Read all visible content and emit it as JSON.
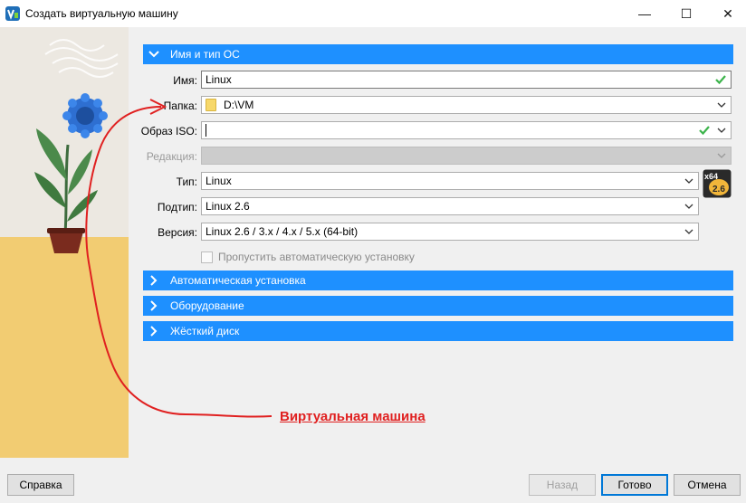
{
  "window": {
    "title": "Создать виртуальную машину",
    "controls": {
      "minimize": "—",
      "maximize": "☐",
      "close": "✕"
    }
  },
  "sections": {
    "name_os": "Имя и тип ОС",
    "unattended": "Автоматическая установка",
    "hardware": "Оборудование",
    "hard_disk": "Жёсткий диск"
  },
  "form": {
    "name": {
      "label": "Имя:",
      "value": "Linux"
    },
    "folder": {
      "label": "Папка:",
      "value": "D:\\VM"
    },
    "iso": {
      "label": "Образ ISO:",
      "value": ""
    },
    "edition": {
      "label": "Редакция:",
      "value": ""
    },
    "type": {
      "label": "Тип:",
      "value": "Linux"
    },
    "subtype": {
      "label": "Подтип:",
      "value": "Linux 2.6"
    },
    "version": {
      "label": "Версия:",
      "value": "Linux 2.6 / 3.x / 4.x / 5.x (64-bit)"
    },
    "skip_unattended": {
      "label": "Пропустить автоматическую установку",
      "checked": false
    }
  },
  "os_badge": {
    "arch": "x64",
    "version": "2.6"
  },
  "buttons": {
    "help": "Справка",
    "back": "Назад",
    "finish": "Готово",
    "cancel": "Отмена"
  },
  "annotation": {
    "text": "Виртуальная машина"
  },
  "colors": {
    "accent": "#1e90ff",
    "annotation": "#e02020",
    "valid": "#3cb44b"
  }
}
